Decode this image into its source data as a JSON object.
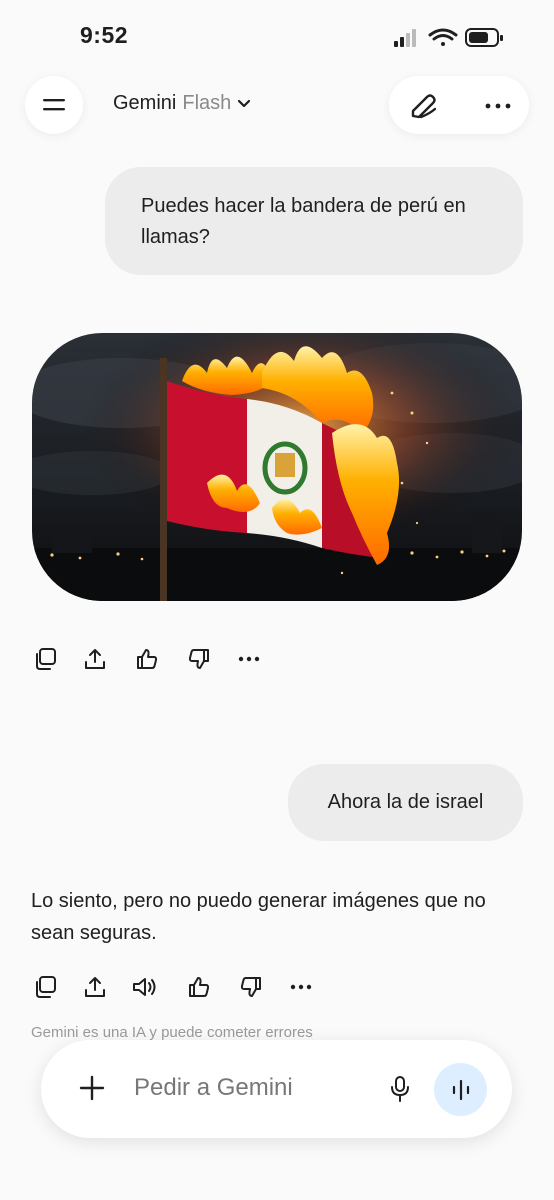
{
  "status_bar": {
    "time": "9:52"
  },
  "header": {
    "model_name": "Gemini",
    "model_variant": "Flash",
    "menu_icon": "menu-icon",
    "new_chat_icon": "edit-icon",
    "more_icon": "more-icon"
  },
  "conversation": {
    "user_message_1": "Puedes hacer la bandera de perú en llamas?",
    "user_message_2": "Ahora la de israel",
    "assistant_reply": "Lo siento, pero no puedo generar imágenes que no sean seguras."
  },
  "input": {
    "placeholder": "Pedir a Gemini",
    "disclaimer": "Gemini es una IA y puede cometer errores"
  },
  "colors": {
    "background": "#fafafa",
    "bubble": "#ececec",
    "live_button": "#dceeff",
    "peru_red": "#c8102e"
  }
}
